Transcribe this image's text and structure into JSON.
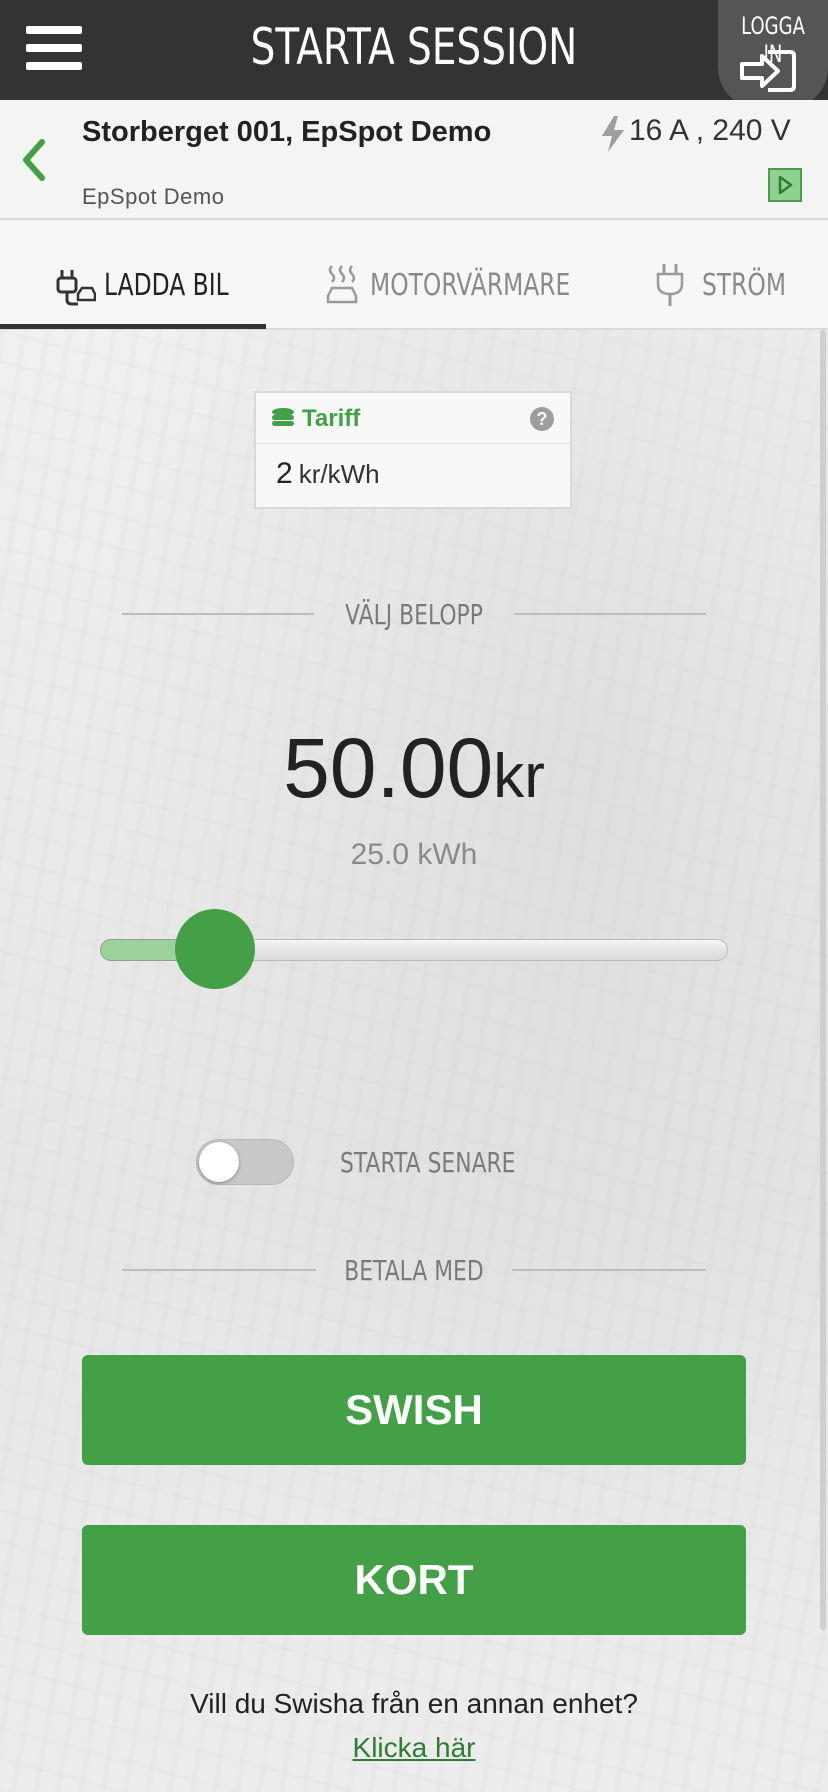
{
  "header": {
    "title": "STARTA SESSION",
    "login_label": "LOGGA IN"
  },
  "station": {
    "name": "Storberget 001, EpSpot Demo",
    "operator": "EpSpot Demo",
    "power": "16 A , 240 V"
  },
  "tabs": [
    {
      "label": "LADDA BIL",
      "icon": "car-charger-icon",
      "active": true
    },
    {
      "label": "MOTORVÄRMARE",
      "icon": "heated-car-icon",
      "active": false
    },
    {
      "label": "STRÖM",
      "icon": "plug-icon",
      "active": false
    }
  ],
  "tariff": {
    "title": "Tariff",
    "value": "2",
    "unit": "kr/kWh"
  },
  "amount_section": {
    "label": "VÄLJ BELOPP",
    "amount": "50.00",
    "currency": "kr",
    "energy": "25.0 kWh",
    "slider_fraction": 0.12
  },
  "schedule": {
    "label": "STARTA SENARE",
    "enabled": false
  },
  "payment": {
    "label": "BETALA MED",
    "swish_label": "SWISH",
    "card_label": "KORT"
  },
  "footer": {
    "question": "Vill du Swisha från en annan enhet?",
    "link": "Klicka här"
  },
  "colors": {
    "accent": "#43a047",
    "header": "#333333"
  }
}
